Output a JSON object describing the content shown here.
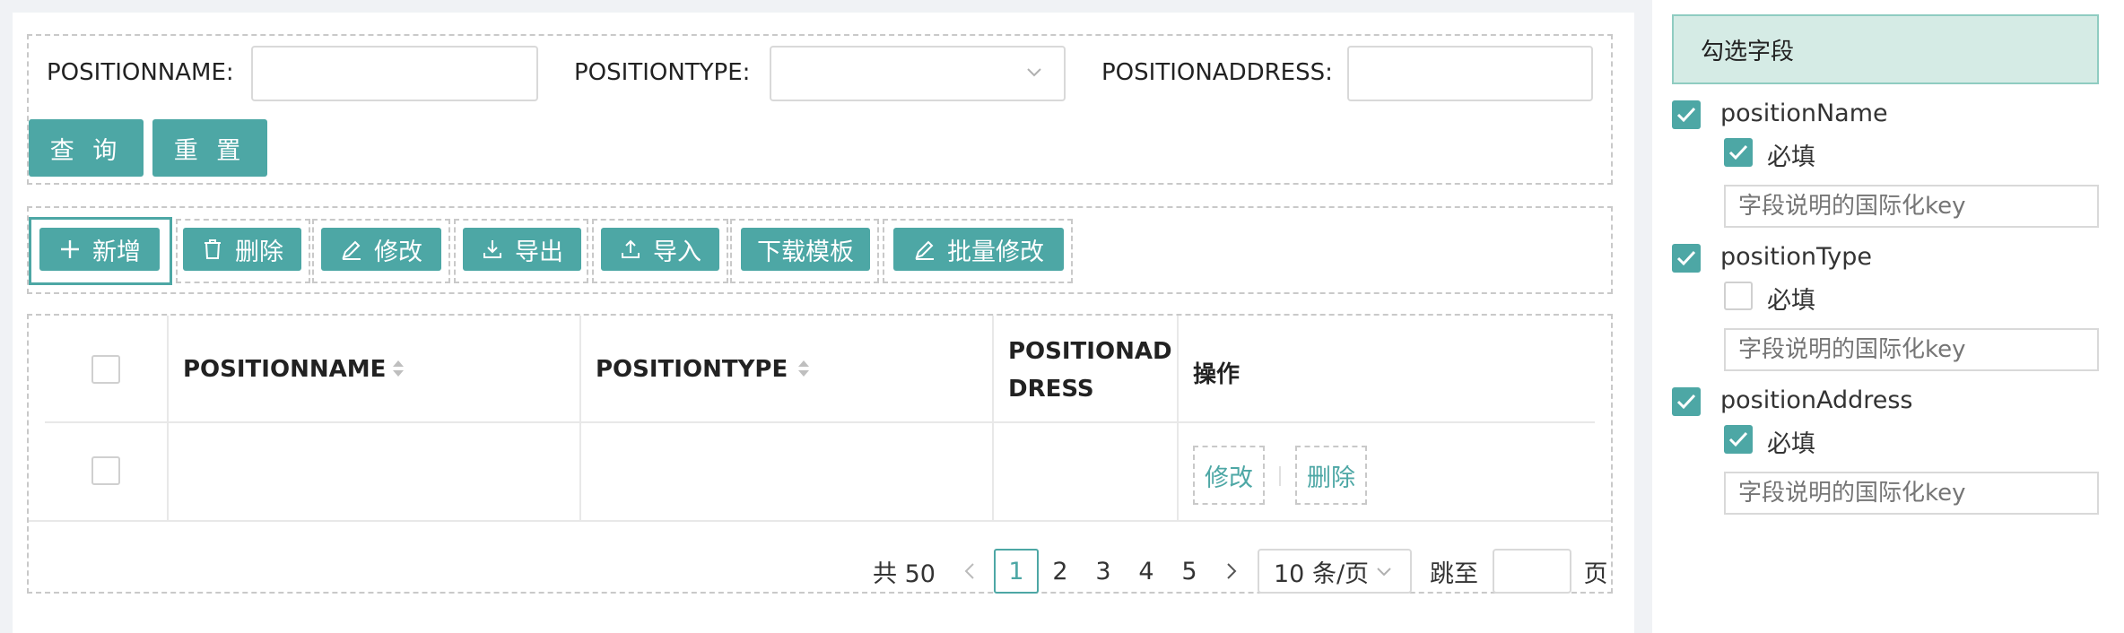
{
  "search_form": {
    "fields": [
      {
        "label": "POSITIONNAME:",
        "value": "",
        "placeholder": ""
      },
      {
        "label": "POSITIONTYPE:",
        "value": "",
        "placeholder": ""
      },
      {
        "label": "POSITIONADDRESS:",
        "value": "",
        "placeholder": ""
      }
    ],
    "query_label": "查 询",
    "reset_label": "重 置"
  },
  "toolbar": {
    "buttons": [
      {
        "label": "新增",
        "icon": "plus-icon"
      },
      {
        "label": "删除",
        "icon": "trash-icon"
      },
      {
        "label": "修改",
        "icon": "edit-icon"
      },
      {
        "label": "导出",
        "icon": "download-icon"
      },
      {
        "label": "导入",
        "icon": "upload-icon"
      },
      {
        "label": "下载模板",
        "icon": ""
      },
      {
        "label": "批量修改",
        "icon": "edit-icon"
      }
    ]
  },
  "table": {
    "columns": [
      {
        "label": "POSITIONNAME",
        "sortable": true
      },
      {
        "label": "POSITIONTYPE",
        "sortable": true
      },
      {
        "label_line1": "POSITIONAD",
        "label_line2": "DRESS",
        "sortable": false
      },
      {
        "label": "操作",
        "sortable": false
      }
    ],
    "rows": [
      {
        "positionName": "",
        "positionType": "",
        "positionAddress": "",
        "actions": [
          "修改",
          "删除"
        ]
      }
    ]
  },
  "pagination": {
    "total_text": "共 50",
    "pages": [
      "1",
      "2",
      "3",
      "4",
      "5"
    ],
    "current_page": "1",
    "page_size_label": "10 条/页",
    "jump_label": "跳至",
    "page_suffix": "页",
    "jump_value": ""
  },
  "field_panel": {
    "title": "勾选字段",
    "required_label": "必填",
    "key_placeholder": "字段说明的国际化key",
    "fields": [
      {
        "name": "positionName",
        "checked": true,
        "required": true
      },
      {
        "name": "positionType",
        "checked": true,
        "required": false
      },
      {
        "name": "positionAddress",
        "checked": true,
        "required": true
      }
    ]
  },
  "colors": {
    "accent": "#4da7a5",
    "panel_header_bg": "#d5ebe5",
    "page_bg": "#f0f2f5"
  }
}
